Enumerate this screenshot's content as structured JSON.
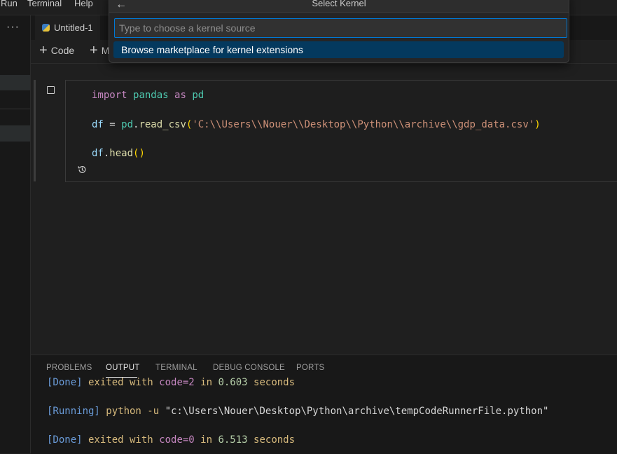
{
  "menubar": {
    "items": [
      "Run",
      "Terminal",
      "Help"
    ]
  },
  "sidebar": {
    "more_icon": "ellipsis-icon",
    "more_label": "···"
  },
  "tab": {
    "label": "Untitled-1",
    "icon": "python-file-icon"
  },
  "notebook_toolbar": {
    "code_label": "Code",
    "markdown_label_partial": "M"
  },
  "cell": {
    "lines": {
      "l1": {
        "kw": "import",
        "mod1": "pandas",
        "as": "as",
        "mod2": "pd"
      },
      "l2": {
        "var": "df",
        "eq": " = ",
        "obj": "pd",
        "dot": ".",
        "fn": "read_csv",
        "open": "(",
        "str": "'C:\\\\Users\\\\Nouer\\\\Desktop\\\\Python\\\\archive\\\\gdp_data.csv'",
        "close": ")"
      },
      "l3": {
        "var": "df",
        "dot": ".",
        "fn": "head",
        "parens": "()"
      }
    }
  },
  "panel": {
    "tabs": [
      "PROBLEMS",
      "OUTPUT",
      "TERMINAL",
      "DEBUG CONSOLE",
      "PORTS"
    ],
    "active_tab": "OUTPUT",
    "output": {
      "line1": {
        "tag": "[Done]",
        "text1": " exited with ",
        "code": "code=2",
        "text2": " in ",
        "num": "0.603",
        "text3": " seconds"
      },
      "line2": {
        "tag": "[Running]",
        "text": " python -u ",
        "path": "\"c:\\Users\\Nouer\\Desktop\\Python\\archive\\tempCodeRunnerFile.python\""
      },
      "line3": {
        "tag": "[Done]",
        "text1": " exited with ",
        "code": "code=0",
        "text2": " in ",
        "num": "6.513",
        "text3": " seconds"
      }
    }
  },
  "quick_pick": {
    "title": "Select Kernel",
    "back_icon": "arrow-left-icon",
    "back_glyph": "←",
    "placeholder": "Type to choose a kernel source",
    "items": [
      "Browse marketplace for kernel extensions"
    ]
  },
  "colors": {
    "accent": "#0078d4",
    "selection": "#04395e",
    "background": "#1f1f1f"
  }
}
